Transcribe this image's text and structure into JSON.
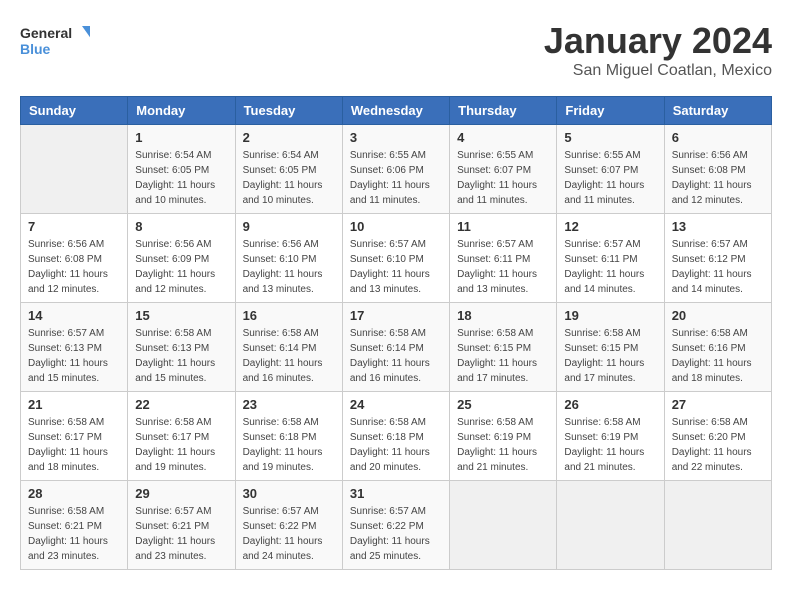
{
  "header": {
    "logo_line1": "General",
    "logo_line2": "Blue",
    "title": "January 2024",
    "subtitle": "San Miguel Coatlan, Mexico"
  },
  "calendar": {
    "days_of_week": [
      "Sunday",
      "Monday",
      "Tuesday",
      "Wednesday",
      "Thursday",
      "Friday",
      "Saturday"
    ],
    "weeks": [
      [
        {
          "day": "",
          "detail": ""
        },
        {
          "day": "1",
          "detail": "Sunrise: 6:54 AM\nSunset: 6:05 PM\nDaylight: 11 hours and 10 minutes."
        },
        {
          "day": "2",
          "detail": "Sunrise: 6:54 AM\nSunset: 6:05 PM\nDaylight: 11 hours and 10 minutes."
        },
        {
          "day": "3",
          "detail": "Sunrise: 6:55 AM\nSunset: 6:06 PM\nDaylight: 11 hours and 11 minutes."
        },
        {
          "day": "4",
          "detail": "Sunrise: 6:55 AM\nSunset: 6:07 PM\nDaylight: 11 hours and 11 minutes."
        },
        {
          "day": "5",
          "detail": "Sunrise: 6:55 AM\nSunset: 6:07 PM\nDaylight: 11 hours and 11 minutes."
        },
        {
          "day": "6",
          "detail": "Sunrise: 6:56 AM\nSunset: 6:08 PM\nDaylight: 11 hours and 12 minutes."
        }
      ],
      [
        {
          "day": "7",
          "detail": "Sunrise: 6:56 AM\nSunset: 6:08 PM\nDaylight: 11 hours and 12 minutes."
        },
        {
          "day": "8",
          "detail": "Sunrise: 6:56 AM\nSunset: 6:09 PM\nDaylight: 11 hours and 12 minutes."
        },
        {
          "day": "9",
          "detail": "Sunrise: 6:56 AM\nSunset: 6:10 PM\nDaylight: 11 hours and 13 minutes."
        },
        {
          "day": "10",
          "detail": "Sunrise: 6:57 AM\nSunset: 6:10 PM\nDaylight: 11 hours and 13 minutes."
        },
        {
          "day": "11",
          "detail": "Sunrise: 6:57 AM\nSunset: 6:11 PM\nDaylight: 11 hours and 13 minutes."
        },
        {
          "day": "12",
          "detail": "Sunrise: 6:57 AM\nSunset: 6:11 PM\nDaylight: 11 hours and 14 minutes."
        },
        {
          "day": "13",
          "detail": "Sunrise: 6:57 AM\nSunset: 6:12 PM\nDaylight: 11 hours and 14 minutes."
        }
      ],
      [
        {
          "day": "14",
          "detail": "Sunrise: 6:57 AM\nSunset: 6:13 PM\nDaylight: 11 hours and 15 minutes."
        },
        {
          "day": "15",
          "detail": "Sunrise: 6:58 AM\nSunset: 6:13 PM\nDaylight: 11 hours and 15 minutes."
        },
        {
          "day": "16",
          "detail": "Sunrise: 6:58 AM\nSunset: 6:14 PM\nDaylight: 11 hours and 16 minutes."
        },
        {
          "day": "17",
          "detail": "Sunrise: 6:58 AM\nSunset: 6:14 PM\nDaylight: 11 hours and 16 minutes."
        },
        {
          "day": "18",
          "detail": "Sunrise: 6:58 AM\nSunset: 6:15 PM\nDaylight: 11 hours and 17 minutes."
        },
        {
          "day": "19",
          "detail": "Sunrise: 6:58 AM\nSunset: 6:15 PM\nDaylight: 11 hours and 17 minutes."
        },
        {
          "day": "20",
          "detail": "Sunrise: 6:58 AM\nSunset: 6:16 PM\nDaylight: 11 hours and 18 minutes."
        }
      ],
      [
        {
          "day": "21",
          "detail": "Sunrise: 6:58 AM\nSunset: 6:17 PM\nDaylight: 11 hours and 18 minutes."
        },
        {
          "day": "22",
          "detail": "Sunrise: 6:58 AM\nSunset: 6:17 PM\nDaylight: 11 hours and 19 minutes."
        },
        {
          "day": "23",
          "detail": "Sunrise: 6:58 AM\nSunset: 6:18 PM\nDaylight: 11 hours and 19 minutes."
        },
        {
          "day": "24",
          "detail": "Sunrise: 6:58 AM\nSunset: 6:18 PM\nDaylight: 11 hours and 20 minutes."
        },
        {
          "day": "25",
          "detail": "Sunrise: 6:58 AM\nSunset: 6:19 PM\nDaylight: 11 hours and 21 minutes."
        },
        {
          "day": "26",
          "detail": "Sunrise: 6:58 AM\nSunset: 6:19 PM\nDaylight: 11 hours and 21 minutes."
        },
        {
          "day": "27",
          "detail": "Sunrise: 6:58 AM\nSunset: 6:20 PM\nDaylight: 11 hours and 22 minutes."
        }
      ],
      [
        {
          "day": "28",
          "detail": "Sunrise: 6:58 AM\nSunset: 6:21 PM\nDaylight: 11 hours and 23 minutes."
        },
        {
          "day": "29",
          "detail": "Sunrise: 6:57 AM\nSunset: 6:21 PM\nDaylight: 11 hours and 23 minutes."
        },
        {
          "day": "30",
          "detail": "Sunrise: 6:57 AM\nSunset: 6:22 PM\nDaylight: 11 hours and 24 minutes."
        },
        {
          "day": "31",
          "detail": "Sunrise: 6:57 AM\nSunset: 6:22 PM\nDaylight: 11 hours and 25 minutes."
        },
        {
          "day": "",
          "detail": ""
        },
        {
          "day": "",
          "detail": ""
        },
        {
          "day": "",
          "detail": ""
        }
      ]
    ]
  }
}
